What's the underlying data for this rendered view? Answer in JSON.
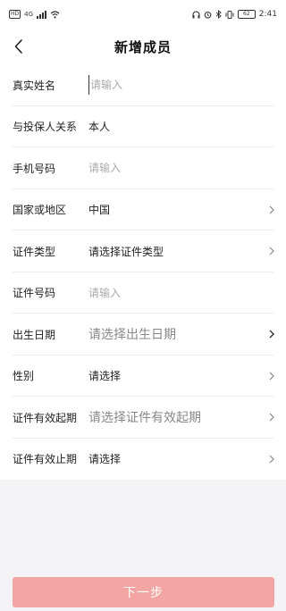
{
  "status_bar": {
    "hd": "HD",
    "network": "4G",
    "battery": "62",
    "time": "2:41"
  },
  "header": {
    "title": "新增成员"
  },
  "form": {
    "real_name": {
      "label": "真实姓名",
      "placeholder": "请输入"
    },
    "relation": {
      "label": "与投保人关系",
      "value": "本人"
    },
    "phone": {
      "label": "手机号码",
      "placeholder": "请输入"
    },
    "country": {
      "label": "国家或地区",
      "value": "中国"
    },
    "id_type": {
      "label": "证件类型",
      "value": "请选择证件类型"
    },
    "id_number": {
      "label": "证件号码",
      "placeholder": "请输入"
    },
    "birth_date": {
      "label": "出生日期",
      "value": "请选择出生日期"
    },
    "gender": {
      "label": "性别",
      "value": "请选择"
    },
    "id_valid_start": {
      "label": "证件有效起期",
      "value": "请选择证件有效起期"
    },
    "id_valid_end": {
      "label": "证件有效止期",
      "value": "请选择"
    }
  },
  "footer": {
    "next_label": "下一步"
  },
  "colors": {
    "accent_disabled": "#f2a5a2",
    "background": "#f4f4f6"
  },
  "icons": [
    "back-arrow-icon",
    "chevron-right-icon",
    "signal-icon",
    "wifi-icon",
    "headphone-icon",
    "alarm-icon",
    "bluetooth-icon",
    "vibrate-icon",
    "battery-icon"
  ]
}
